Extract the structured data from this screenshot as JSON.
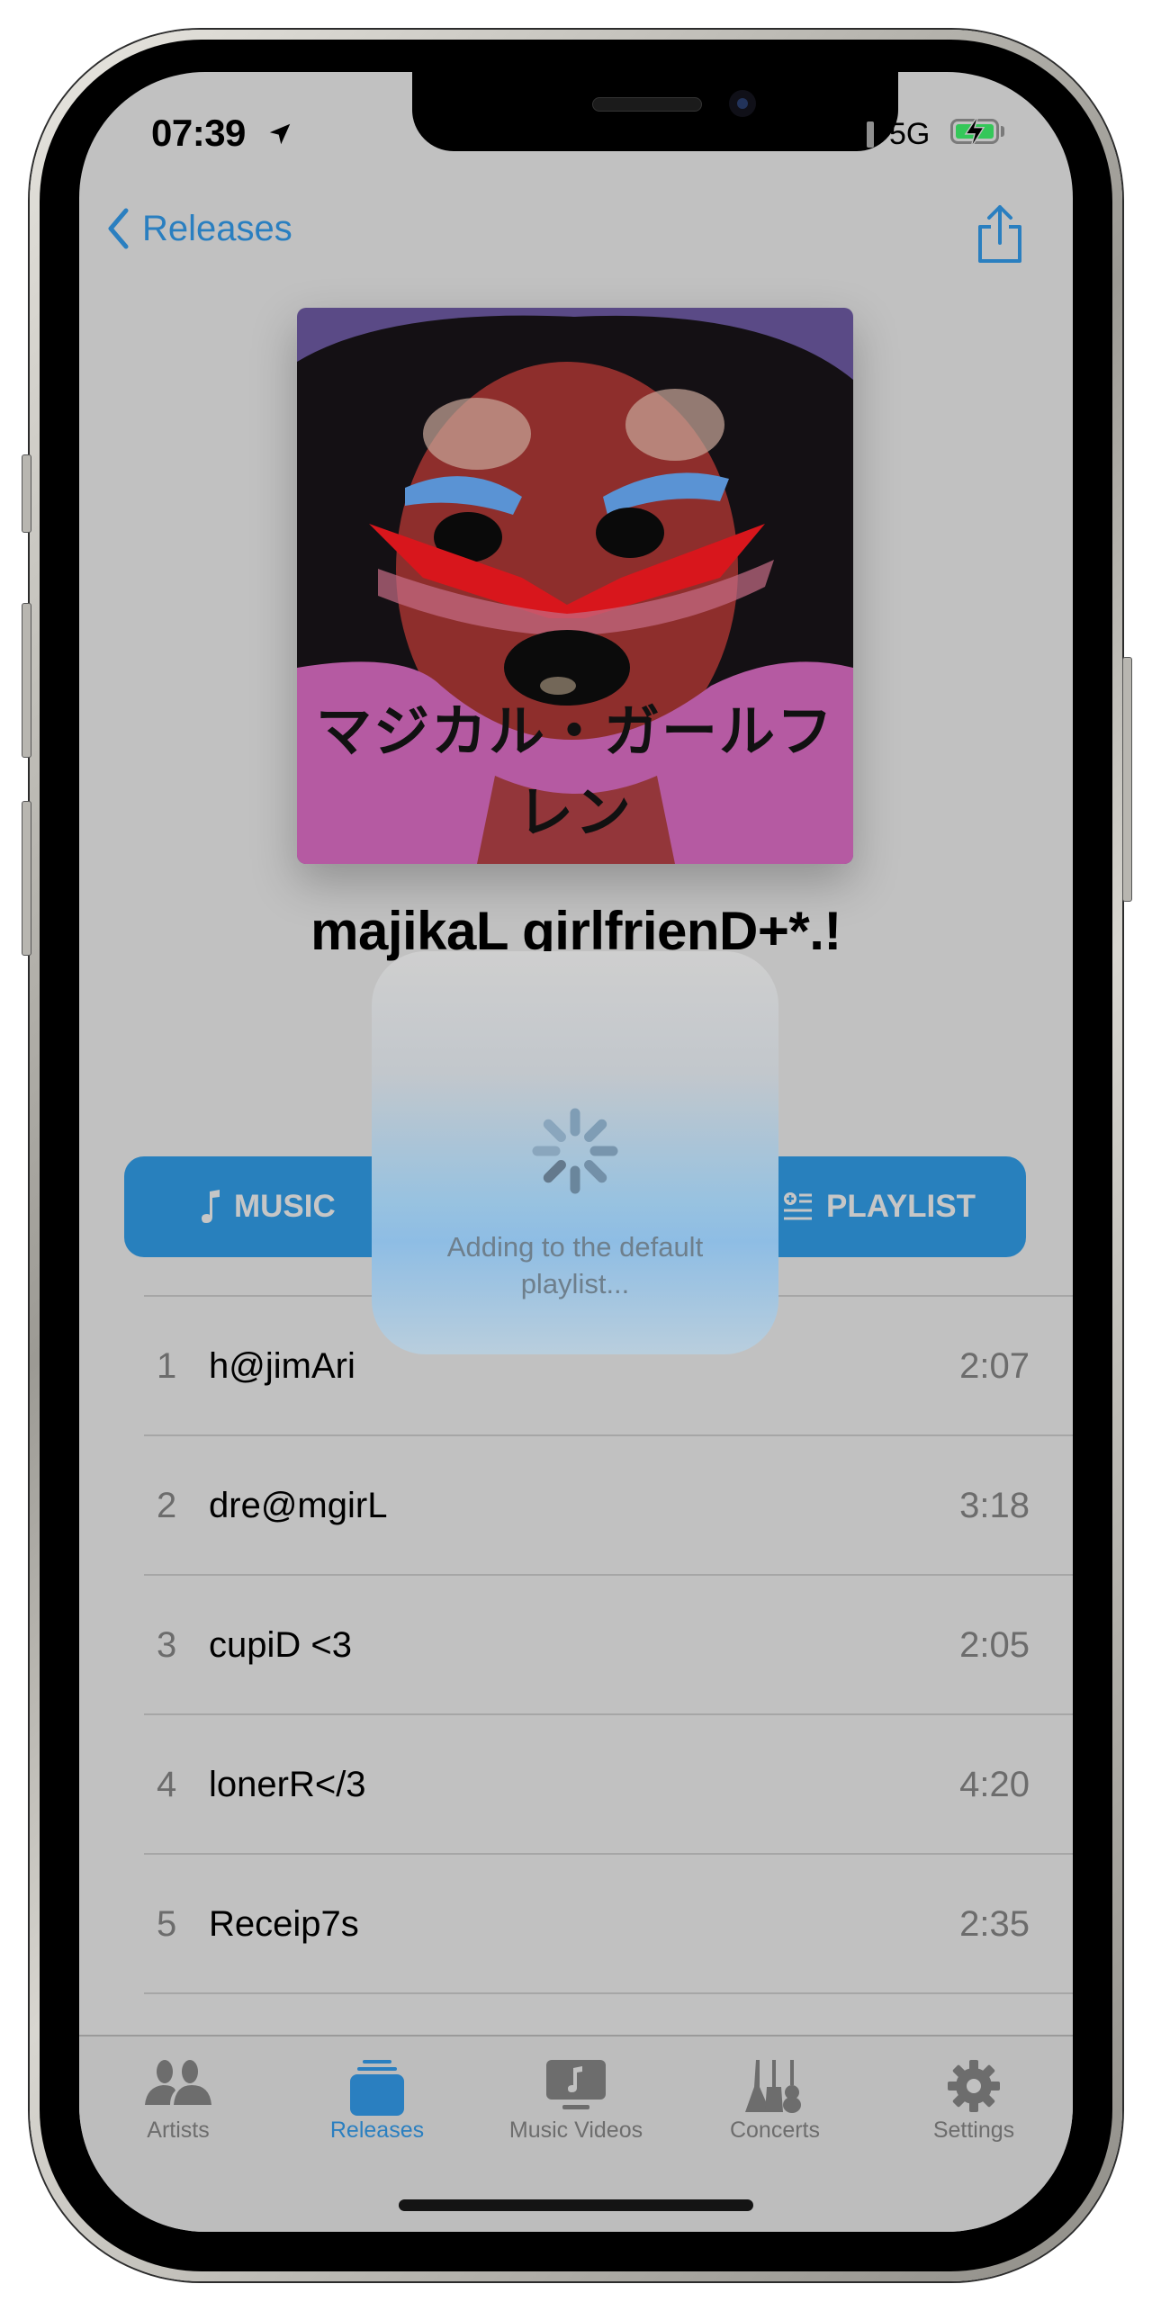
{
  "status_bar": {
    "time": "07:39",
    "location_icon": "location-arrow-icon",
    "signal_icon": "cellular-signal-icon",
    "network": "5G",
    "battery_icon": "battery-charging-icon",
    "battery_color": "#34c759"
  },
  "nav": {
    "back_label": "Releases",
    "back_icon": "chevron-left-icon",
    "share_icon": "share-icon",
    "accent_color": "#2a7fc0"
  },
  "album": {
    "art_caption": "マジカル・ガールフレン",
    "title": "majikaL girlfrienD+*.!"
  },
  "actions": {
    "music_label": "MUSIC",
    "music_icon": "music-note-icon",
    "playlist_label": "PLAYLIST",
    "playlist_icon": "add-to-playlist-icon",
    "button_color": "#2880bd"
  },
  "tracks": [
    {
      "number": "1",
      "title": "h@jimAri",
      "duration": "2:07"
    },
    {
      "number": "2",
      "title": "dre@mgirL",
      "duration": "3:18"
    },
    {
      "number": "3",
      "title": "cupiD <3",
      "duration": "2:05"
    },
    {
      "number": "4",
      "title": "lonerR</3",
      "duration": "4:20"
    },
    {
      "number": "5",
      "title": "Receip7s",
      "duration": "2:35"
    }
  ],
  "hud": {
    "message": "Adding to the default playlist...",
    "icon": "activity-spinner-icon"
  },
  "tab_bar": {
    "active": "Releases",
    "tabs": [
      {
        "label": "Artists",
        "icon": "people-icon"
      },
      {
        "label": "Releases",
        "icon": "album-stack-icon"
      },
      {
        "label": "Music Videos",
        "icon": "music-video-icon"
      },
      {
        "label": "Concerts",
        "icon": "guitars-icon"
      },
      {
        "label": "Settings",
        "icon": "gear-icon"
      }
    ]
  }
}
